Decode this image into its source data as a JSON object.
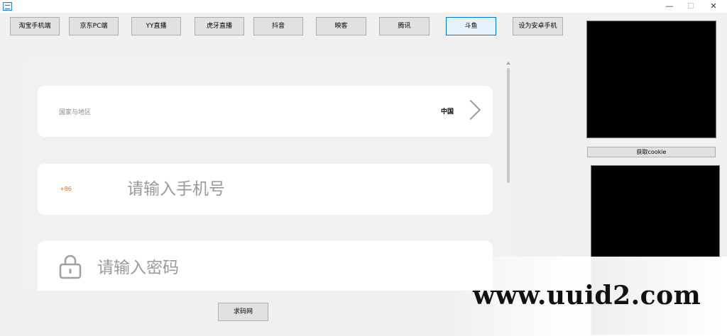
{
  "window": {
    "min_label": "—",
    "max_label": "☐",
    "close_label": "✕",
    "icon": "app-icon"
  },
  "toolbar": {
    "buttons": [
      {
        "label": "淘宝手机端"
      },
      {
        "label": "京东PC端"
      },
      {
        "label": "YY直播"
      },
      {
        "label": "虎牙直播"
      },
      {
        "label": "抖音"
      },
      {
        "label": "映客"
      },
      {
        "label": "腾讯"
      },
      {
        "label": "斗鱼",
        "active": true
      },
      {
        "label": "设为安卓手机"
      }
    ]
  },
  "login_form": {
    "country_label": "国家与地区",
    "country_value": "中国",
    "phone_code": "+86",
    "phone_placeholder": "请输入手机号",
    "password_placeholder": "请输入密码"
  },
  "bottom_button_label": "求码网",
  "side_panel": {
    "cookie_button_label": "获取cookie"
  },
  "watermark": "www.uuid2.com",
  "colors": {
    "active_border": "#0078d7",
    "phone_code": "#e07020",
    "black_panel": "#000000"
  }
}
